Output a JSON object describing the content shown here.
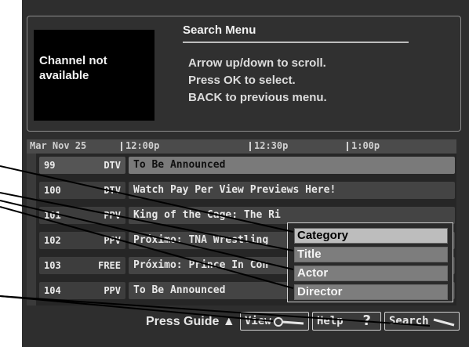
{
  "preview": {
    "text_line1": "Channel not",
    "text_line2": "available"
  },
  "search_menu": {
    "title": "Search Menu",
    "instructions": [
      "Arrow up/down to scroll.",
      "Press OK to select.",
      "BACK to previous menu."
    ]
  },
  "guide": {
    "date": "Mar Nov 25",
    "times": [
      "12:00p",
      "12:30p",
      "1:00p"
    ],
    "rows": [
      {
        "number": "99",
        "network": "DTV",
        "program": "To Be Announced",
        "selected": true
      },
      {
        "number": "100",
        "network": "DTV",
        "program": "Watch Pay Per View Previews Here!",
        "selected": false
      },
      {
        "number": "101",
        "network": "PPV",
        "program": "King of the Cage: The Ri",
        "selected": false
      },
      {
        "number": "102",
        "network": "PPV",
        "program": "Próximo: TNA Wrestling",
        "selected": false
      },
      {
        "number": "103",
        "network": "FREE",
        "program": "Próximo: Prince In Con",
        "selected": false
      },
      {
        "number": "104",
        "network": "PPV",
        "program": "To Be Announced",
        "selected": false
      }
    ]
  },
  "search_options": [
    {
      "label": "Category",
      "active": true
    },
    {
      "label": "Title",
      "active": false
    },
    {
      "label": "Actor",
      "active": false
    },
    {
      "label": "Director",
      "active": false
    }
  ],
  "bottom_bar": {
    "press_guide": "Press Guide ▲",
    "view_label": "View",
    "help_label": "Help",
    "help_glyph": "?",
    "search_label": "Search"
  }
}
